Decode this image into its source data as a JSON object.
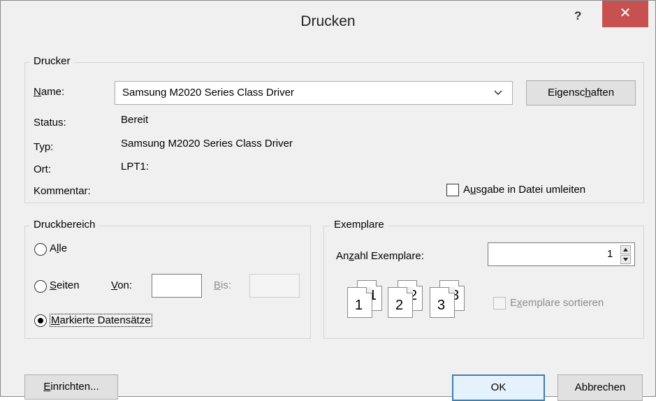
{
  "window": {
    "title": "Drucken",
    "help_label": "?",
    "close_label": "✕"
  },
  "printer": {
    "group_label": "Drucker",
    "name_label_u": "N",
    "name_label_rest": "ame:",
    "name_value": "Samsung M2020 Series Class Driver",
    "properties_pre": "Eigensc",
    "properties_u": "h",
    "properties_post": "aften",
    "status_label": "Status:",
    "status_value": "Bereit",
    "type_label": "Typ:",
    "type_value": "Samsung M2020 Series Class Driver",
    "location_label": "Ort:",
    "location_value": "LPT1:",
    "comment_label": "Kommentar:",
    "redirect_pre": "A",
    "redirect_u": "u",
    "redirect_post": "sgabe in Datei umleiten"
  },
  "range": {
    "group_label": "Druckbereich",
    "all_pre": "A",
    "all_u": "l",
    "all_post": "le",
    "pages_u": "S",
    "pages_post": "eiten",
    "from_u": "V",
    "from_post": "on:",
    "from_value": "",
    "to_u": "B",
    "to_post": "is:",
    "to_value": "",
    "selected_u": "M",
    "selected_post": "arkierte Datensätze"
  },
  "copies": {
    "group_label": "Exemplare",
    "count_pre": "An",
    "count_u": "z",
    "count_post": "ahl Exemplare:",
    "count_value": "1",
    "collate_pre": "E",
    "collate_u": "x",
    "collate_post": "emplare sortieren",
    "page_digits": [
      "1",
      "1",
      "2",
      "2",
      "3",
      "3"
    ]
  },
  "buttons": {
    "setup_u": "E",
    "setup_post": "inrichten...",
    "ok": "OK",
    "cancel": "Abbrechen"
  }
}
